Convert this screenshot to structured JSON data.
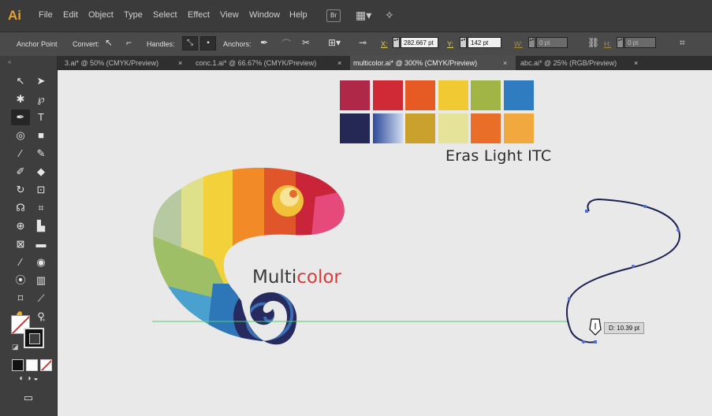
{
  "app": {
    "logo": "Ai",
    "bridge_label": "Br"
  },
  "menu": [
    "File",
    "Edit",
    "Object",
    "Type",
    "Select",
    "Effect",
    "View",
    "Window",
    "Help"
  ],
  "control": {
    "anchor_point": "Anchor Point",
    "convert": "Convert:",
    "handles": "Handles:",
    "anchors": "Anchors:",
    "x_label": "X:",
    "x_value": "282.667 pt",
    "y_label": "Y:",
    "y_value": "142 pt",
    "w_label": "W:",
    "w_value": "0 pt",
    "h_label": "H:",
    "h_value": "0 pt"
  },
  "tabs": [
    {
      "label": "3.ai* @ 50% (CMYK/Preview)",
      "close": "×"
    },
    {
      "label": "conc.1.ai* @ 66.67% (CMYK/Preview)",
      "close": "×"
    },
    {
      "label": "multicolor.ai* @ 300% (CMYK/Preview)",
      "close": "×"
    },
    {
      "label": "abc.ai* @ 25% (RGB/Preview)",
      "close": "×"
    }
  ],
  "artboard": {
    "swatches_row1": [
      "#b02847",
      "#cf2a36",
      "#e65a24",
      "#f1c932",
      "#a1b446",
      "#2f7cc0"
    ],
    "swatches_row2": [
      "#252855",
      "#8fb0dc",
      "#c9a12c",
      "#e5e299",
      "#e96e27",
      "#f1a83f"
    ],
    "font_label": "Eras Light ITC",
    "logo_text_a": "Multi",
    "logo_text_b": "color",
    "distance_tip": "D: 10.39 pt"
  }
}
